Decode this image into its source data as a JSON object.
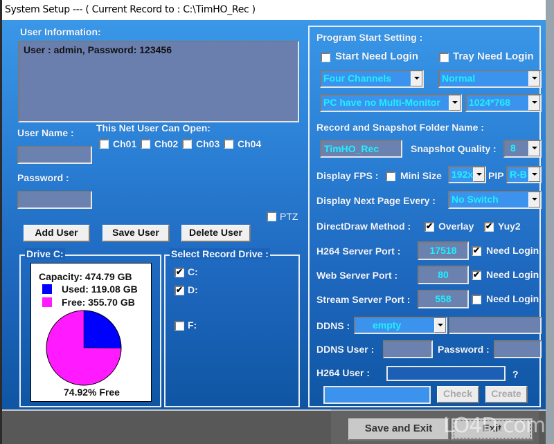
{
  "window": {
    "title": "System Setup --- ( Current Record to : C:\\TimHO_Rec )"
  },
  "user_info": {
    "heading": "User Information:",
    "list_text": "User : admin, Password: 123456",
    "user_name_label": "User Name :",
    "user_name_value": "",
    "password_label": "Password :",
    "password_value": "",
    "net_user_label": "This Net User Can Open:",
    "channels": [
      {
        "label": "Ch01",
        "checked": false
      },
      {
        "label": "Ch02",
        "checked": false
      },
      {
        "label": "Ch03",
        "checked": false
      },
      {
        "label": "Ch04",
        "checked": false
      }
    ],
    "ptz": {
      "label": "PTZ",
      "checked": false
    },
    "add_user": "Add User",
    "save_user": "Save User",
    "delete_user": "Delete User"
  },
  "drive": {
    "group_title": "Drive C:",
    "capacity": "Capacity: 474.79 GB",
    "used": "Used: 119.08 GB",
    "free": "Free: 355.70 GB",
    "free_percent": "74.92% Free",
    "used_color": "#0000ff",
    "free_color": "#ff1aff"
  },
  "chart_data": {
    "type": "pie",
    "title": "Drive C:",
    "categories": [
      "Used",
      "Free"
    ],
    "values": [
      119.08,
      355.7
    ],
    "units": "GB",
    "colors": [
      "#0000ff",
      "#ff1aff"
    ],
    "annotation": "74.92% Free",
    "legend": "top"
  },
  "record_drive": {
    "group_title": "Select Record Drive :",
    "drives": [
      {
        "label": "C:",
        "checked": true
      },
      {
        "label": "D:",
        "checked": true
      },
      {
        "label": "F:",
        "checked": false
      }
    ]
  },
  "program_start": {
    "heading": "Program Start Setting :",
    "start_need_login": {
      "label": "Start Need Login",
      "checked": false
    },
    "tray_need_login": {
      "label": "Tray Need Login",
      "checked": false
    },
    "channels_select": "Four Channels",
    "mode_select": "Normal",
    "monitor_select": "PC have no Multi-Monitor",
    "resolution_select": "1024*768"
  },
  "folder": {
    "heading": "Record and Snapshot Folder Name :",
    "value": "TimHO_Rec",
    "snapshot_quality_label": "Snapshot Quality :",
    "snapshot_quality_value": "8"
  },
  "display": {
    "fps_label": "Display FPS :",
    "fps_checked": false,
    "mini_size_label": "Mini Size",
    "mini_size_value": "192x",
    "pip_label": "PIP",
    "pip_value": "R-B",
    "next_page_label": "Display Next Page Every :",
    "next_page_value": "No Switch",
    "directdraw_label": "DirectDraw Method :",
    "overlay": {
      "label": "Overlay",
      "checked": true
    },
    "yuy2": {
      "label": "Yuy2",
      "checked": true
    }
  },
  "ports": [
    {
      "label": "H264 Server Port :",
      "value": "17518",
      "need_login_label": "Need Login",
      "checked": true
    },
    {
      "label": "Web Server Port :",
      "value": "80",
      "need_login_label": "Need Login",
      "checked": true
    },
    {
      "label": "Stream Server Port :",
      "value": "558",
      "need_login_label": "Need Login",
      "checked": false
    }
  ],
  "ddns": {
    "label": "DDNS :",
    "select_value": "empty",
    "host_value": "",
    "user_label": "DDNS User :",
    "user_value": "",
    "password_label": "Password :",
    "password_value": "",
    "h264_user_label": "H264 User :",
    "h264_user_value": "",
    "help": "?",
    "code_value": "",
    "check": "Check",
    "create": "Create"
  },
  "footer": {
    "save_exit": "Save and Exit",
    "exit": "Exit"
  },
  "watermark": {
    "text": "LO4D.com"
  }
}
